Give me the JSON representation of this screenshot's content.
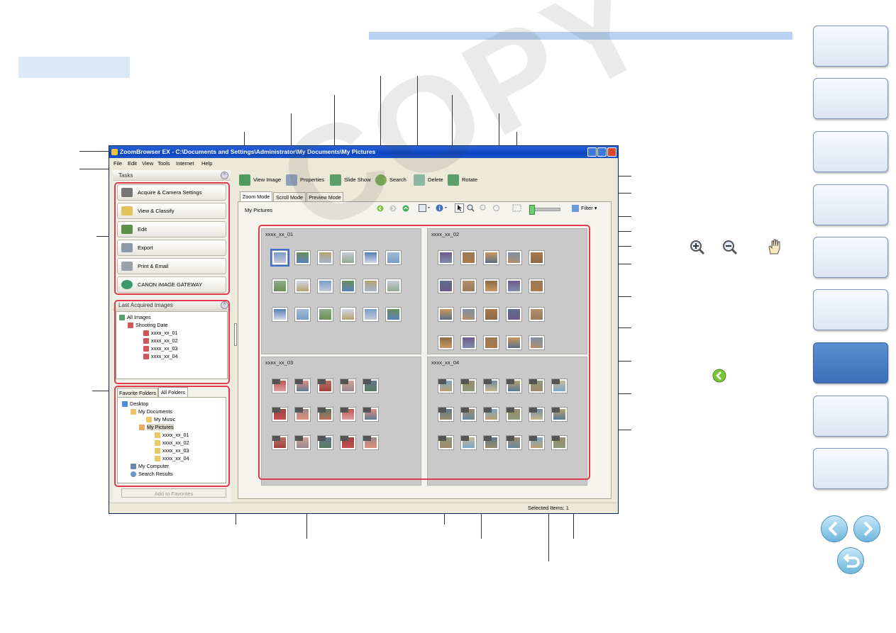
{
  "window": {
    "title": "ZoomBrowser EX  -  C:\\Documents and Settings\\Administrator\\My Documents\\My Pictures",
    "menus": [
      "File",
      "Edit",
      "View",
      "Tools",
      "Internet",
      "Help"
    ]
  },
  "tasks": {
    "header": "Tasks",
    "items": [
      "Acquire & Camera Settings",
      "View & Classify",
      "Edit",
      "Export",
      "Print & Email",
      "CANON iMAGE GATEWAY"
    ]
  },
  "last_acquired": {
    "header": "Last Acquired Images",
    "all_images": "All Images",
    "shooting_date": "Shooting Date",
    "dates": [
      "xxxx_xx_01",
      "xxxx_xx_02",
      "xxxx_xx_03",
      "xxxx_xx_04"
    ]
  },
  "folders": {
    "tabs": [
      "Favorite Folders",
      "All Folders"
    ],
    "desktop": "Desktop",
    "my_documents": "My Documents",
    "my_music": "My Music",
    "my_pictures": "My Pictures",
    "subfolders": [
      "xxxx_xx_01",
      "xxxx_xx_02",
      "xxxx_xx_03",
      "xxxx_xx_04"
    ],
    "my_computer": "My Computer",
    "search_results": "Search Results",
    "add_button": "Add to Favorites"
  },
  "toolbar": {
    "view_image": "View Image",
    "properties": "Properties",
    "slide_show": "Slide Show",
    "search": "Search",
    "delete": "Delete",
    "rotate": "Rotate",
    "filter": "Filter"
  },
  "mode_tabs": [
    "Zoom Mode",
    "Scroll Mode",
    "Preview Mode"
  ],
  "content": {
    "location": "My Pictures",
    "groups": [
      "xxxx_xx_01",
      "xxxx_xx_02",
      "xxxx_xx_03",
      "xxxx_xx_04"
    ]
  },
  "status": {
    "selected": "Selected Items: 1"
  },
  "colors": {
    "accent": "#4a7cc5",
    "highlight": "#e23a4a",
    "title_bar": "#0c45c0"
  }
}
